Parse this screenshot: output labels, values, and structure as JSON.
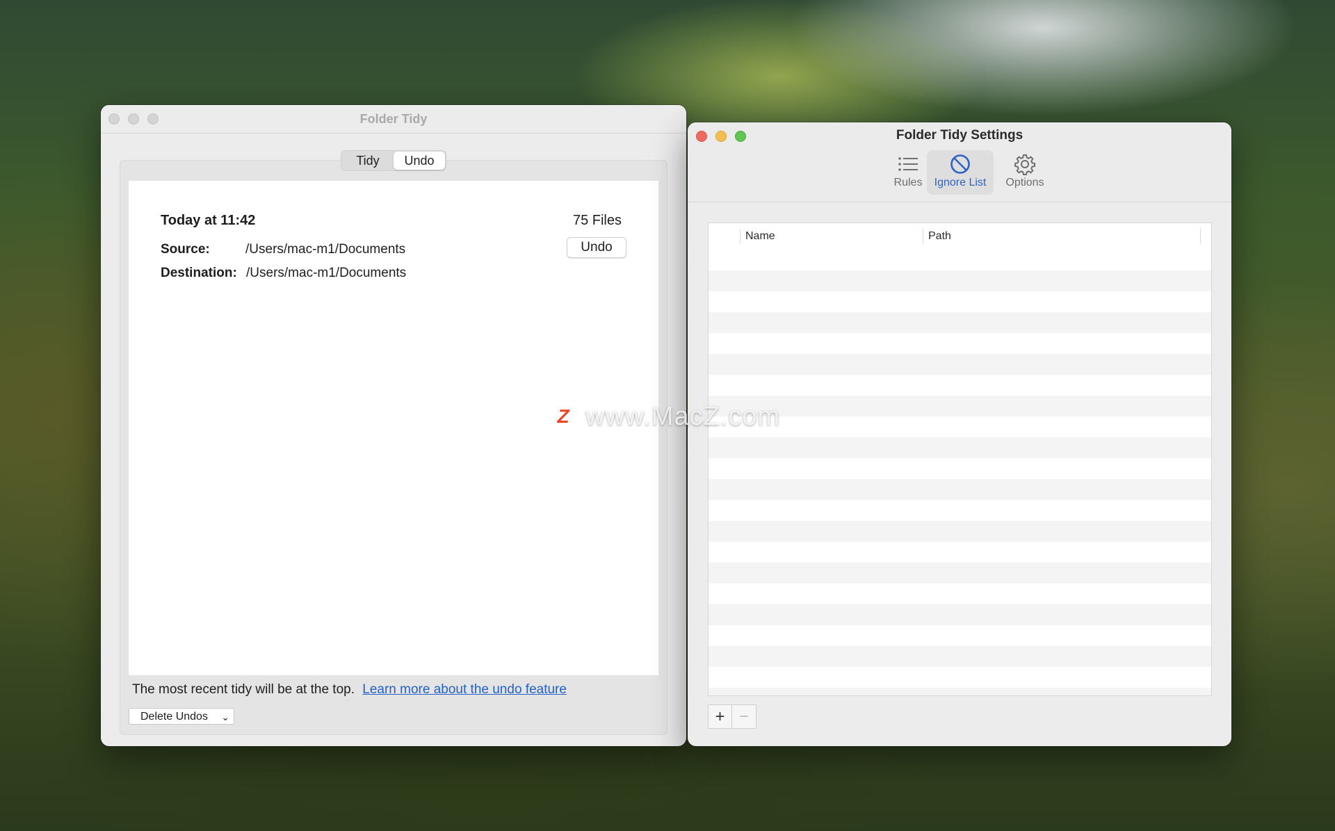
{
  "tidy_window": {
    "title": "Folder Tidy",
    "tabs": [
      {
        "label": "Tidy",
        "selected": false
      },
      {
        "label": "Undo",
        "selected": true
      }
    ],
    "entry": {
      "date": "Today at 11:42",
      "file_count": "75 Files",
      "source_label": "Source:",
      "source_value": "/Users/mac-m1/Documents",
      "destination_label": "Destination:",
      "destination_value": "/Users/mac-m1/Documents",
      "undo_button": "Undo"
    },
    "footer_text": "The most recent tidy will be at the top.",
    "footer_link": "Learn more about the undo feature",
    "delete_popup": {
      "selected": "Delete Undos"
    }
  },
  "settings_window": {
    "title": "Folder Tidy Settings",
    "toolbar": [
      {
        "label": "Rules",
        "icon": "list-icon",
        "selected": false
      },
      {
        "label": "Ignore List",
        "icon": "prohibited-icon",
        "selected": true
      },
      {
        "label": "Options",
        "icon": "gear-icon",
        "selected": false
      }
    ],
    "table": {
      "columns": [
        "Name",
        "Path"
      ],
      "rows": []
    },
    "add_button": "+",
    "remove_button": "−"
  },
  "watermark": {
    "logo": "Z",
    "text": "www.MacZ.com"
  },
  "colors": {
    "accent": "#2e62c9",
    "link": "#2461c4",
    "close": "#ed6a5e",
    "minimize": "#f5bf4f",
    "zoom": "#61c554"
  }
}
